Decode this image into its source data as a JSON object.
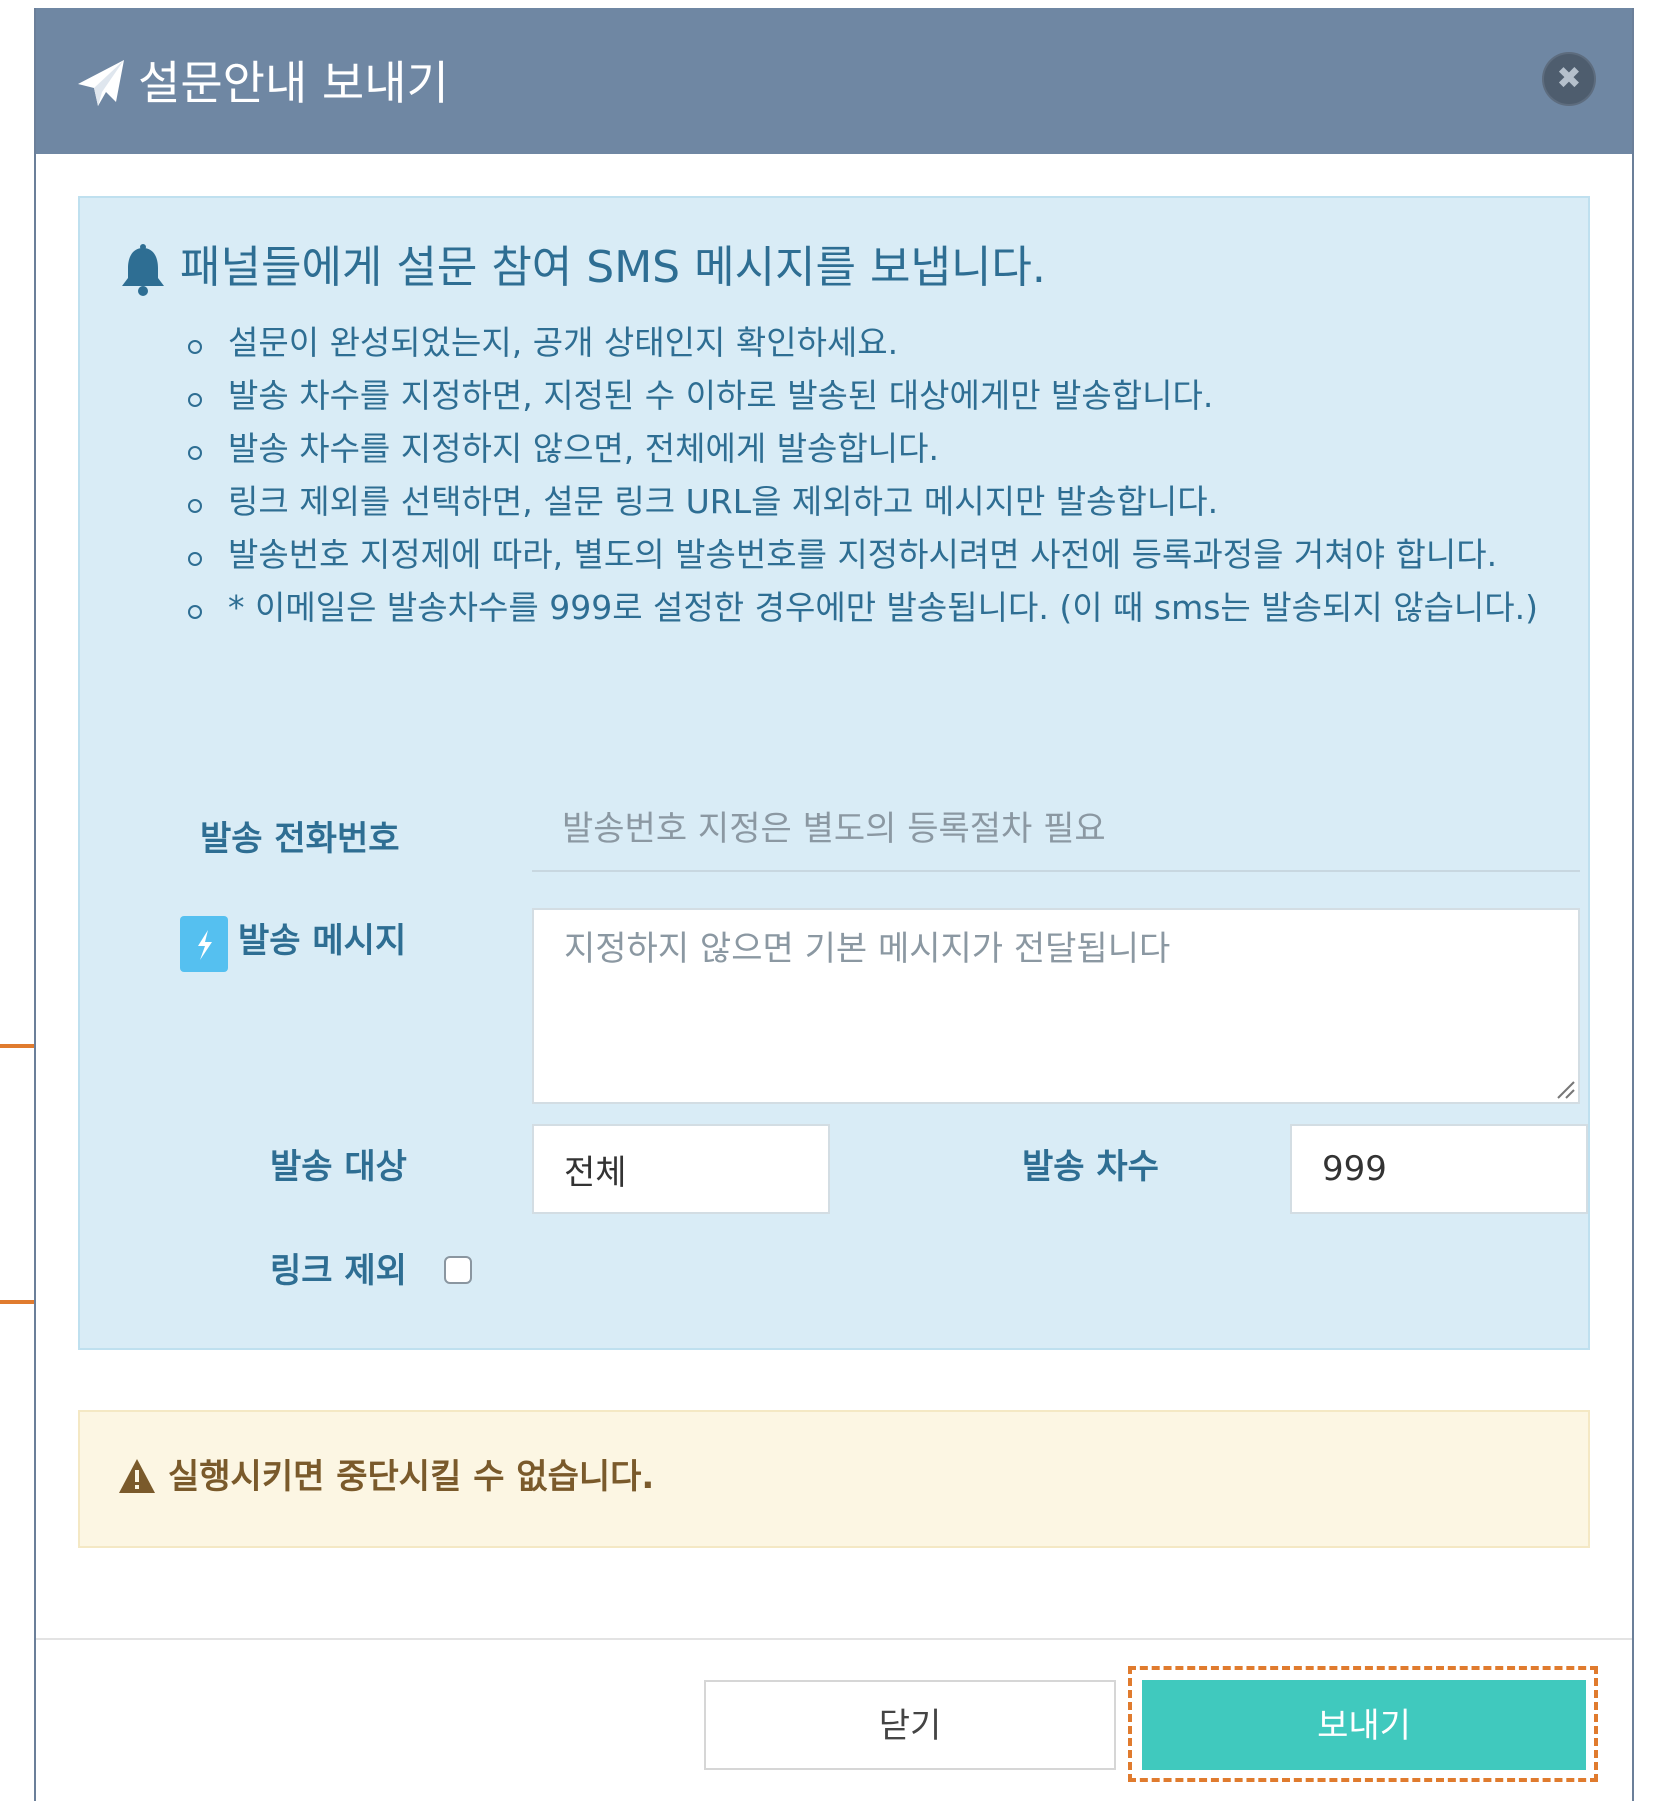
{
  "dialog": {
    "title": "설문안내 보내기",
    "close_label": "✖"
  },
  "info": {
    "heading": "패널들에게 설문 참여 SMS 메시지를 보냅니다.",
    "items": [
      "설문이 완성되었는지, 공개 상태인지 확인하세요.",
      "발송 차수를 지정하면, 지정된 수 이하로 발송된 대상에게만 발송합니다.",
      "발송 차수를 지정하지 않으면, 전체에게 발송합니다.",
      "링크 제외를 선택하면, 설문 링크 URL을 제외하고 메시지만 발송합니다.",
      "발송번호 지정제에 따라, 별도의 발송번호를 지정하시려면 사전에 등록과정을 거쳐야 합니다.",
      "* 이메일은 발송차수를 999로 설정한 경우에만 발송됩니다. (이 때 sms는 발송되지 않습니다.)"
    ]
  },
  "form": {
    "phone_label": "발송 전화번호",
    "phone_value": "발송번호 지정은 별도의 등록절차 필요",
    "message_label": "발송 메시지",
    "message_placeholder": "지정하지 않으면 기본 메시지가 전달됩니다",
    "target_label": "발송 대상",
    "target_value": "전체",
    "round_label": "발송 차수",
    "round_value": "999",
    "exclude_link_label": "링크 제외",
    "exclude_link_checked": false
  },
  "warning": {
    "text": "실행시키면 중단시킬 수 없습니다."
  },
  "footer": {
    "close_label": "닫기",
    "send_label": "보내기"
  },
  "colors": {
    "header_bg": "#6f87a3",
    "info_bg": "#d9ecf6",
    "info_text": "#2e6e93",
    "warning_bg": "#fcf6e3",
    "send_button": "#40c9be",
    "annotation": "#e07b2e"
  },
  "icons": [
    "paper-plane-icon",
    "close-icon",
    "bell-icon",
    "lightning-icon",
    "warning-icon",
    "arrow-right-icon"
  ]
}
